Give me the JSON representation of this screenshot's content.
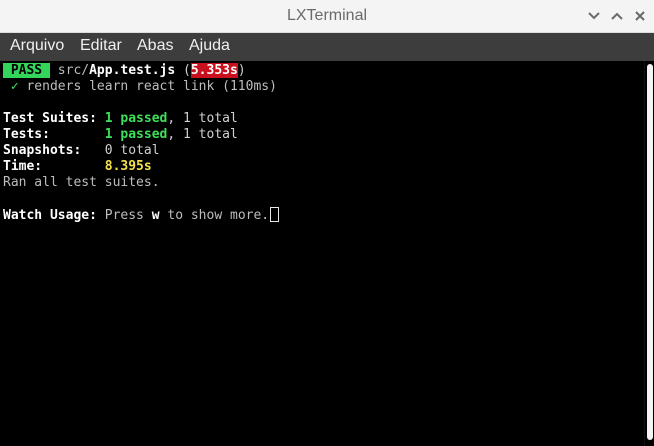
{
  "window": {
    "title": "LXTerminal"
  },
  "menubar": {
    "items": [
      "Arquivo",
      "Editar",
      "Abas",
      "Ajuda"
    ]
  },
  "terminal": {
    "line1": {
      "badge": " PASS ",
      "path_prefix": " src/",
      "filename": "App.test.js",
      "open_paren": " (",
      "duration": "5.353s",
      "close_paren": ")"
    },
    "line2": {
      "check": " ✓",
      "text": " renders learn react link (110ms)"
    },
    "suites": {
      "label": "Test Suites:",
      "passed": " 1 passed",
      "rest": ", 1 total"
    },
    "tests": {
      "label": "Tests:",
      "passed": "       1 passed",
      "rest": ", 1 total"
    },
    "snapshots": {
      "label": "Snapshots:",
      "rest": "   0 total"
    },
    "time": {
      "label": "Time:",
      "value": "        8.395s"
    },
    "ran": {
      "text": "Ran all test suites."
    },
    "watch": {
      "label": "Watch Usage:",
      "pre": " Press ",
      "key": "w",
      "post": " to show more."
    }
  },
  "colors": {
    "pass_badge": "#33d65a",
    "time_badge": "#c8101e",
    "green": "#3de05a",
    "yellow": "#f2e04a",
    "menubar_bg": "#3d3d3d",
    "titlebar_bg": "#f4f4f4"
  },
  "icons": {
    "minimize": "minimize-icon",
    "maximize": "maximize-icon",
    "close": "close-icon"
  }
}
